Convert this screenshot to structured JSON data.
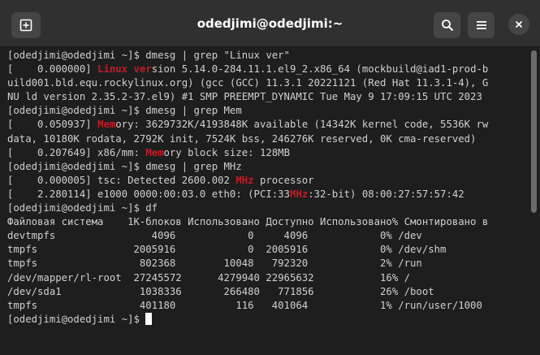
{
  "window": {
    "title": "odedjimi@odedjimi:~",
    "new_tab_icon": "new-tab-icon",
    "search_icon": "search-icon",
    "menu_icon": "hamburger-menu-icon",
    "close_icon": "close-icon"
  },
  "terminal": {
    "highlight_color": "#c01c28",
    "lines": [
      [
        {
          "t": "[odedjimi@odedjimi ~]$ dmesg | grep \"Linux ver\""
        }
      ],
      [
        {
          "t": "[    0.000000] "
        },
        {
          "t": "Linux ver",
          "h": true
        },
        {
          "t": "sion 5.14.0-284.11.1.el9_2.x86_64 (mockbuild@iad1-prod-b"
        }
      ],
      [
        {
          "t": "uild001.bld.equ.rockylinux.org) (gcc (GCC) 11.3.1 20221121 (Red Hat 11.3.1-4), G"
        }
      ],
      [
        {
          "t": "NU ld version 2.35.2-37.el9) #1 SMP PREEMPT_DYNAMIC Tue May 9 17:09:15 UTC 2023"
        }
      ],
      [
        {
          "t": "[odedjimi@odedjimi ~]$ dmesg | grep Mem"
        }
      ],
      [
        {
          "t": "[    0.050937] "
        },
        {
          "t": "Mem",
          "h": true
        },
        {
          "t": "ory: 3629732K/4193848K available (14342K kernel code, 5536K rw"
        }
      ],
      [
        {
          "t": "data, 10180K rodata, 2792K init, 7524K bss, 246276K reserved, 0K cma-reserved)"
        }
      ],
      [
        {
          "t": "[    0.207649] x86/mm: "
        },
        {
          "t": "Mem",
          "h": true
        },
        {
          "t": "ory block size: 128MB"
        }
      ],
      [
        {
          "t": "[odedjimi@odedjimi ~]$ dmesg | grep MHz"
        }
      ],
      [
        {
          "t": "[    0.000005] tsc: Detected 2600.002 "
        },
        {
          "t": "MHz",
          "h": true
        },
        {
          "t": " processor"
        }
      ],
      [
        {
          "t": "[    2.280114] e1000 0000:00:03.0 eth0: (PCI:33"
        },
        {
          "t": "MHz",
          "h": true
        },
        {
          "t": ":32-bit) 08:00:27:57:57:42"
        }
      ],
      [
        {
          "t": "[odedjimi@odedjimi ~]$ df"
        }
      ],
      [
        {
          "t": "Файловая система    1K-блоков Использовано Доступно Использовано% Cмонтировано в"
        }
      ],
      [
        {
          "t": "devtmpfs                4096            0     4096            0% /dev"
        }
      ],
      [
        {
          "t": "tmpfs                2005916            0  2005916            0% /dev/shm"
        }
      ],
      [
        {
          "t": "tmpfs                 802368        10048   792320            2% /run"
        }
      ],
      [
        {
          "t": "/dev/mapper/rl-root  27245572      4279940 22965632           16% /"
        }
      ],
      [
        {
          "t": "/dev/sda1             1038336       266480   771856           26% /boot"
        }
      ],
      [
        {
          "t": "tmpfs                 401180          116   401064            1% /run/user/1000"
        }
      ],
      [
        {
          "t": "[odedjimi@odedjimi ~]$ "
        }
      ]
    ]
  }
}
